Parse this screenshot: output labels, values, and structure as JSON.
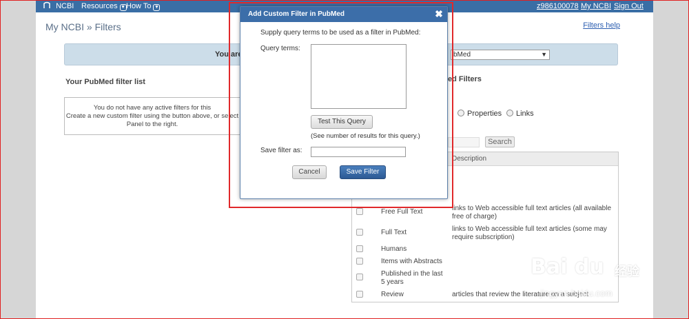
{
  "topbar": {
    "logo": "NCBI",
    "resources": "Resources",
    "howto": "How To",
    "username": "z986100078",
    "my_ncbi": "My NCBI",
    "sign_out": "Sign Out"
  },
  "breadcrumb": "My NCBI » Filters",
  "filters_help": "Filters help",
  "banner": {
    "text": "You are",
    "selected_db_tail": "bMed"
  },
  "left_section": {
    "title": "Your PubMed filter list",
    "empty_line1": "You do not have any active filters for this",
    "empty_line2": "Create a new custom filter using the button above, or select",
    "empty_line3": "Panel to the right."
  },
  "right_section": {
    "title_tail": "ed Filters",
    "radio_properties": "Properties",
    "radio_links": "Links",
    "search_button": "Search",
    "description_header": "Description",
    "rows": [
      {
        "name": "Free Full Text",
        "desc": "links to Web accessible full text articles (all available free of charge)"
      },
      {
        "name": "Full Text",
        "desc": "links to Web accessible full text articles (some may require subscription)"
      },
      {
        "name": "Humans",
        "desc": ""
      },
      {
        "name": "Items with Abstracts",
        "desc": ""
      },
      {
        "name": "Published in the last 5 years",
        "desc": ""
      },
      {
        "name": "Review",
        "desc": "articles that review the literature on a subject"
      }
    ]
  },
  "dialog": {
    "title": "Add Custom Filter in PubMed",
    "close_glyph": "✖",
    "hint": "Supply query terms to be used as a filter in PubMed:",
    "query_label": "Query terms:",
    "query_value": "",
    "test_button": "Test This Query",
    "test_note": "(See number of results for this query.)",
    "save_label": "Save filter as:",
    "save_value": "",
    "cancel_button": "Cancel",
    "save_button": "Save Filter"
  },
  "watermark": {
    "brand": "Bai du",
    "cn": "经验",
    "url": "jingyan.baidu.com"
  },
  "colors": {
    "topbar": "#3a6ea5",
    "dialog_title": "#3c6ea9",
    "highlight": "#e0282a",
    "banner": "#ccdde9"
  }
}
